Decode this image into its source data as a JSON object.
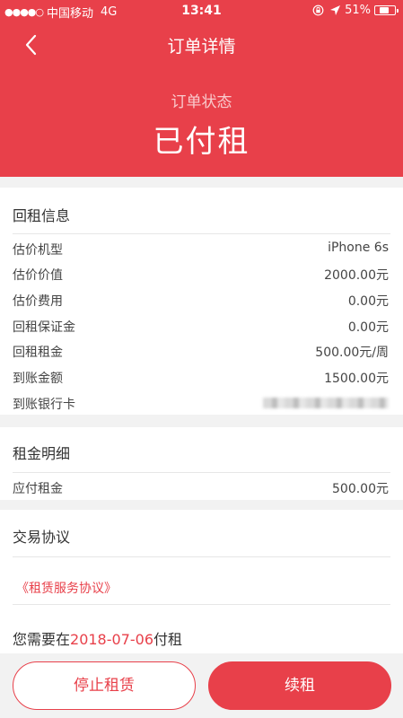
{
  "status_bar": {
    "signal_dots": "●●●●○",
    "carrier": "中国移动",
    "network": "4G",
    "time": "13:41",
    "lock_icon": "orientation-lock-icon",
    "location_icon": "location-arrow-icon",
    "battery_text": "51%",
    "battery_level": 0.51
  },
  "nav": {
    "title": "订单详情",
    "back_icon": "chevron-left-icon"
  },
  "order_status": {
    "label": "订单状态",
    "value": "已付租"
  },
  "rental_info": {
    "title": "回租信息",
    "rows": [
      {
        "label": "估价机型",
        "value": "iPhone 6s"
      },
      {
        "label": "估价价值",
        "value": "2000.00元"
      },
      {
        "label": "估价费用",
        "value": "0.00元"
      },
      {
        "label": "回租保证金",
        "value": "0.00元"
      },
      {
        "label": "回租租金",
        "value": "500.00元/周"
      },
      {
        "label": "到账金额",
        "value": "1500.00元"
      }
    ],
    "bank_card_label": "到账银行卡"
  },
  "rent_detail": {
    "title": "租金明细",
    "rows": [
      {
        "label": "应付租金",
        "value": "500.00元"
      }
    ]
  },
  "agreement": {
    "title": "交易协议",
    "link": "《租赁服务协议》",
    "due_prefix": "您需要在",
    "due_date": "2018-07-06",
    "due_suffix": "付租"
  },
  "actions": {
    "stop_label": "停止租赁",
    "renew_label": "续租"
  },
  "colors": {
    "brand": "#e8404a",
    "background": "#f2f2f2"
  }
}
